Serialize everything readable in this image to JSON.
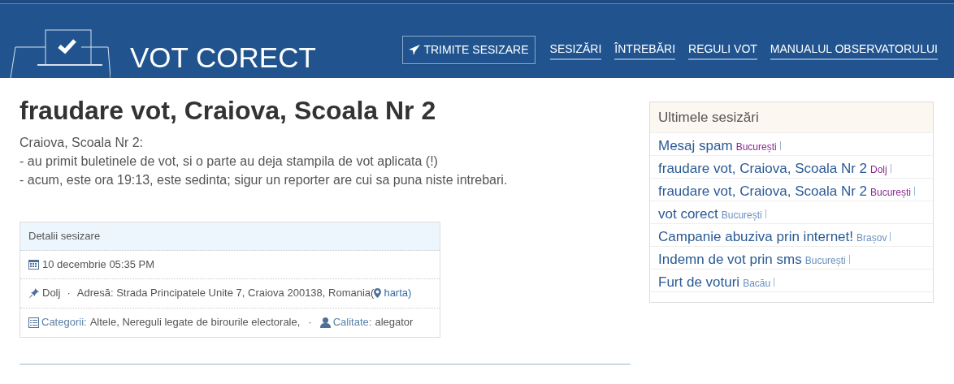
{
  "header": {
    "logo_text": "VOT CORECT",
    "report_button": "TRIMITE SESIZARE",
    "nav": [
      "SESIZĂRI",
      "ÎNTREBĂRI",
      "REGULI VOT",
      "MANUALUL OBSERVATORULUI"
    ]
  },
  "report": {
    "title": "fraudare vot, Craiova, Scoala Nr 2",
    "body_lines": [
      "Craiova, Scoala Nr 2:",
      "- au primit buletinele de vot, si o parte au deja stampila de vot aplicata (!)",
      "- acum, este ora 19:13, este sedinta; sigur un reporter are cui sa puna niste intrebari."
    ]
  },
  "details": {
    "heading": "Detalii sesizare",
    "date": "10 decembrie 05:35 PM",
    "county": "Dolj",
    "separator": "·",
    "address": "Adresă: Strada Principatele Unite 7, Craiova 200138, Romania(",
    "map_link": "harta",
    "address_end": ")",
    "categories_label": "Categorii:",
    "categories": "Altele, Nereguli legate de birourile electorale,",
    "quality_label": "Calitate:",
    "quality": "alegator"
  },
  "sidebar": {
    "heading": "Ultimele sesizări",
    "items": [
      {
        "title": "Mesaj spam",
        "location": "București",
        "visited": true
      },
      {
        "title": "fraudare vot, Craiova, Scoala Nr 2",
        "location": "Dolj",
        "visited": true
      },
      {
        "title": "fraudare vot, Craiova, Scoala Nr 2",
        "location": "București",
        "visited": true
      },
      {
        "title": "vot corect",
        "location": "București",
        "visited": false
      },
      {
        "title": "Campanie abuziva prin internet!",
        "location": "Brașov",
        "visited": false
      },
      {
        "title": "Indemn de vot prin sms",
        "location": "București",
        "visited": false
      },
      {
        "title": "Furt de voturi",
        "location": "Bacău",
        "visited": false
      }
    ]
  }
}
